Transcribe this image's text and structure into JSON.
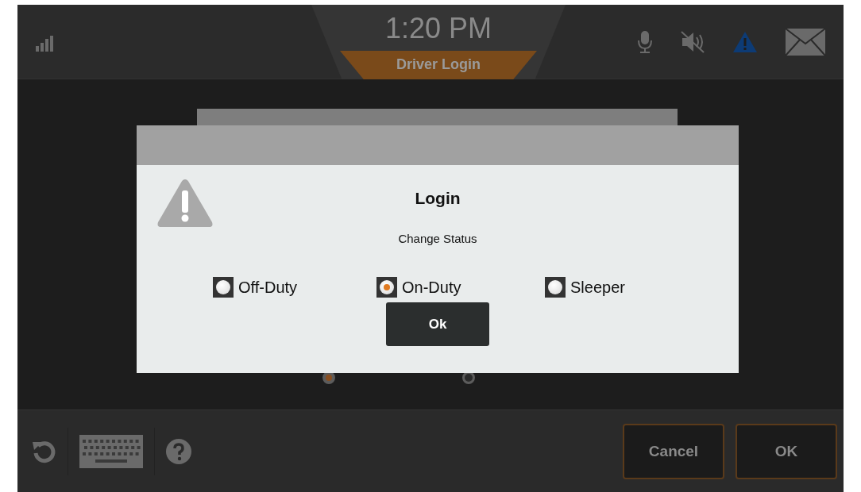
{
  "status_bar": {
    "time": "1:20 PM",
    "screen_title": "Driver Login"
  },
  "background": {
    "options": [
      {
        "selected": true
      },
      {
        "selected": false
      }
    ]
  },
  "dialog": {
    "title": "Login",
    "message": "Change Status",
    "options": [
      {
        "label": "Off-Duty",
        "selected": false
      },
      {
        "label": "On-Duty",
        "selected": true
      },
      {
        "label": "Sleeper",
        "selected": false
      }
    ],
    "button": "Ok"
  },
  "footer": {
    "buttons": [
      "Cancel",
      "OK"
    ]
  }
}
